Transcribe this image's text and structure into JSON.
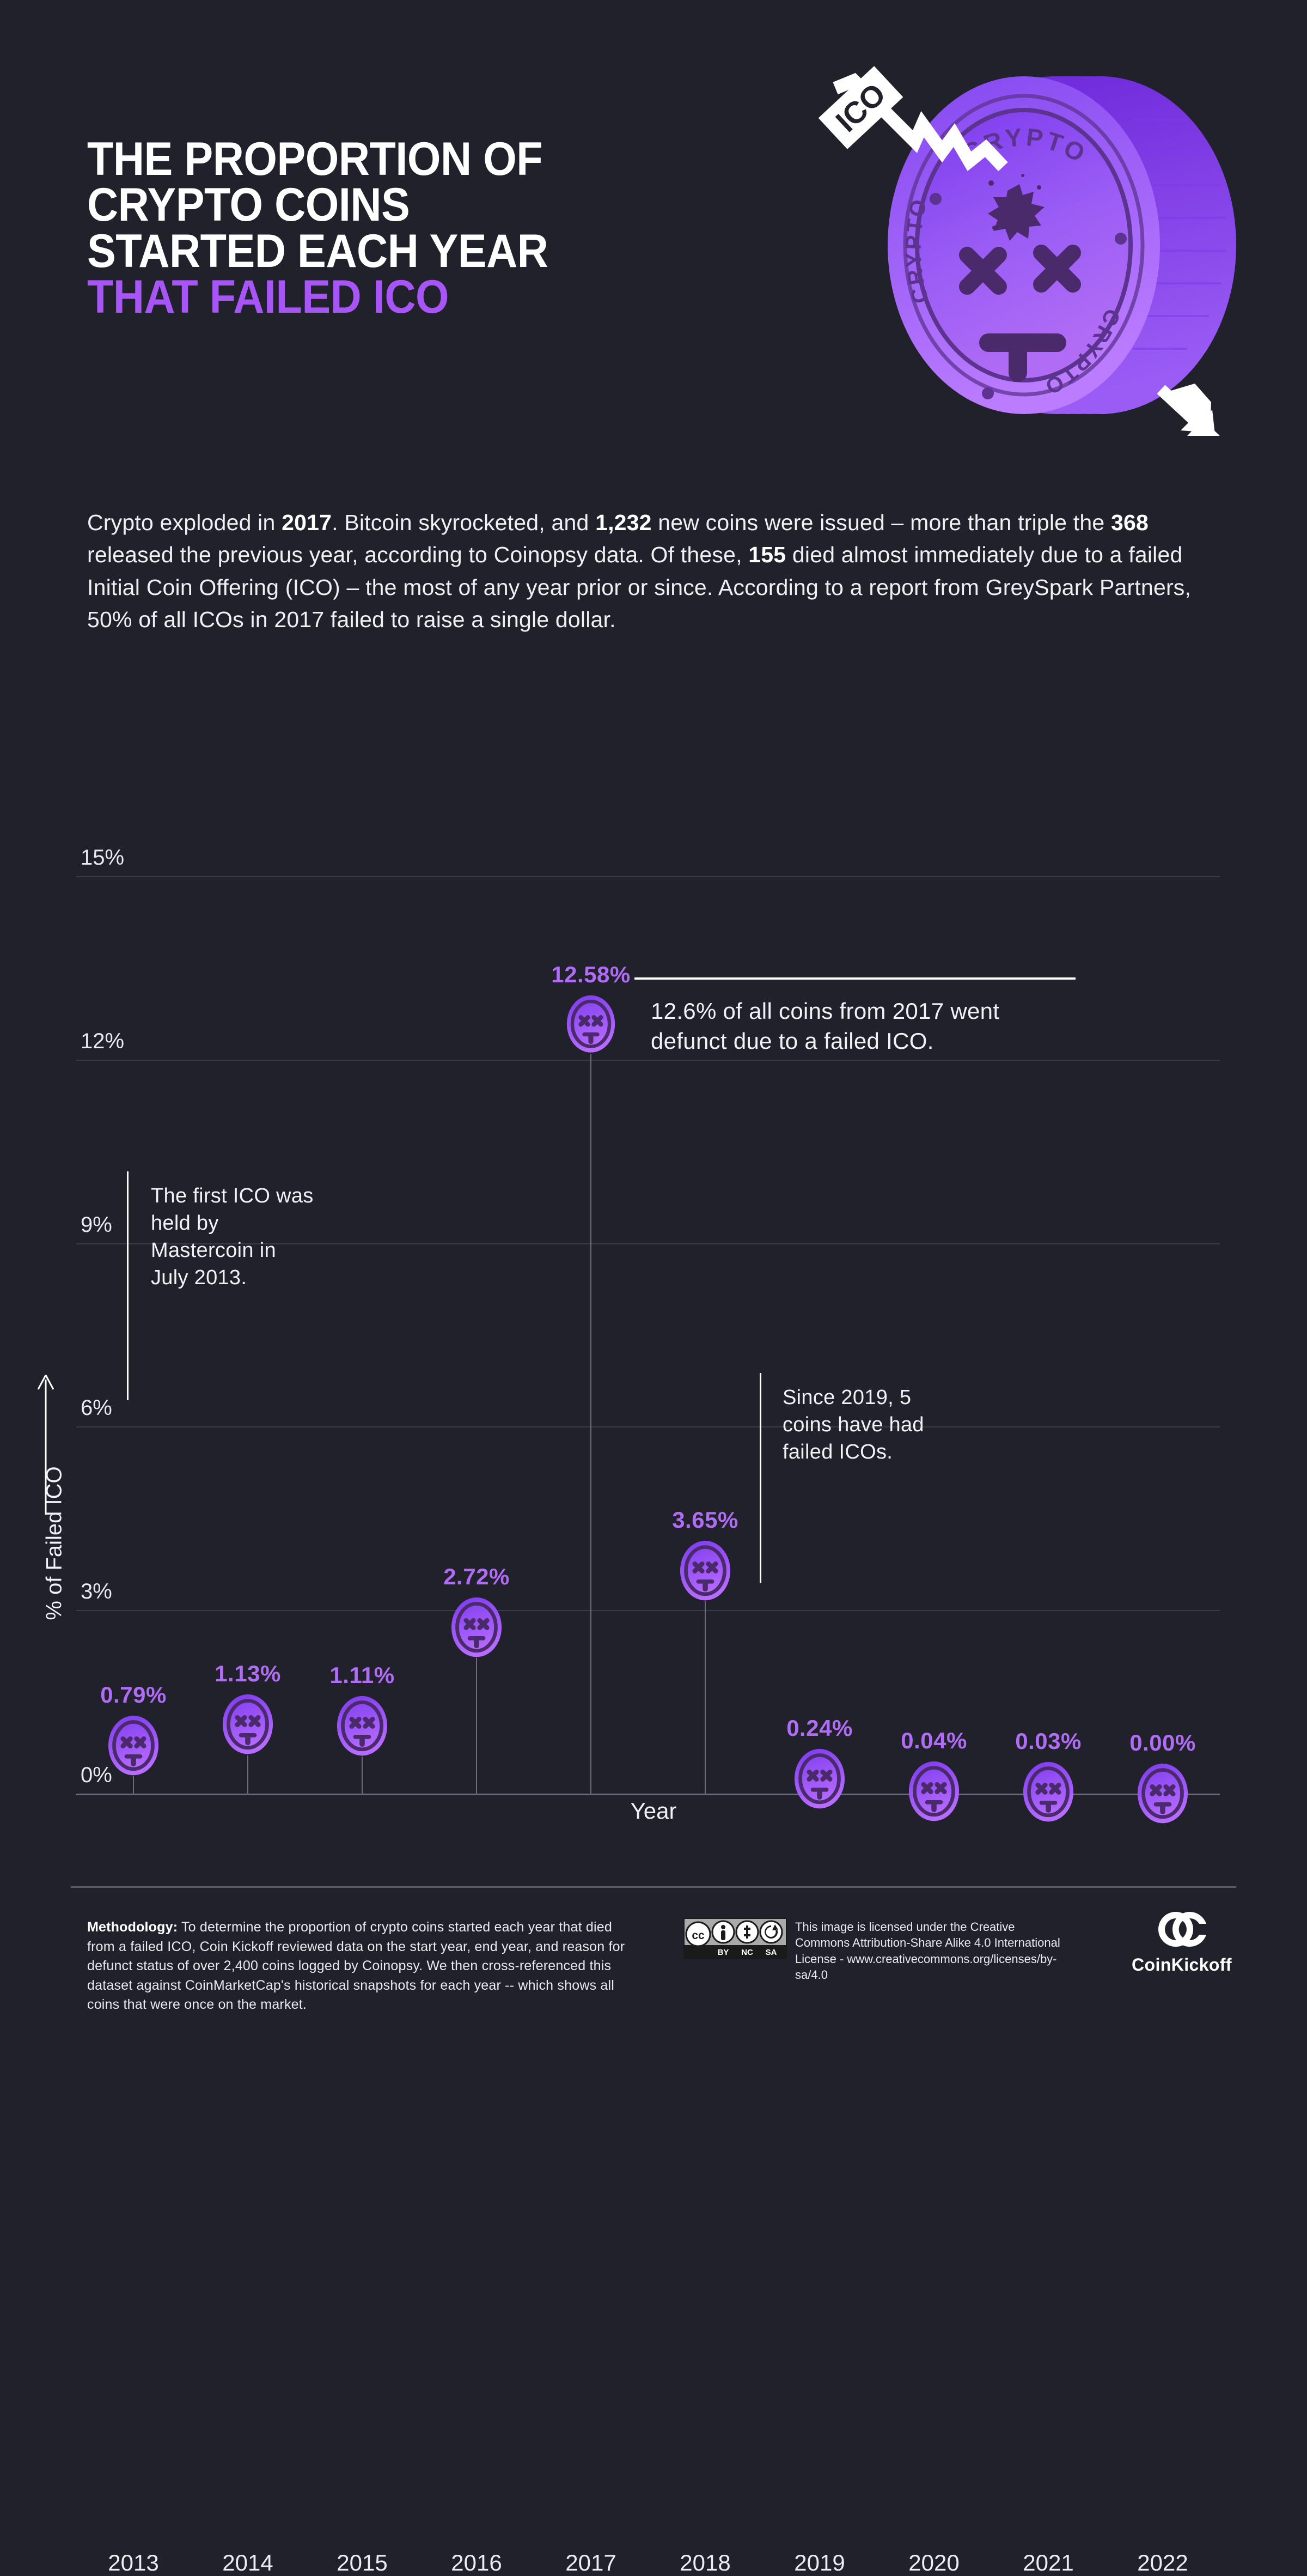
{
  "theme": {
    "background": "#21212c",
    "accent_purple": "#a855f7",
    "label_purple": "#b06cf5",
    "coin_light": "#b388ff",
    "coin_dark": "#7c3aed",
    "coin_outline": "#4a2a6b",
    "text_white": "#ffffff",
    "gridline": "#3a3a48"
  },
  "hero": {
    "title_lines": [
      "THE PROPORTION OF",
      "CRYPTO COINS",
      "STARTED EACH YEAR"
    ],
    "title_accent_line": "THAT FAILED ICO",
    "coin_face_text": "CRYPTO",
    "arrow_tag_label": "ICO"
  },
  "intro": {
    "paragraph_html": "Crypto exploded in <b>2017</b>. Bitcoin skyrocketed, and <b>1,232</b> new coins were issued – more than triple the <b>368</b> released the previous year, according to Coinopsy data. Of these, <b>155</b> died almost immediately due to a failed Initial Coin Offering (ICO) – the most of any year prior or since. According to a report from GreySpark Partners, 50% of all ICOs in 2017 failed to raise a single dollar."
  },
  "chart_data": {
    "type": "scatter",
    "title": "The proportion of crypto coins started each year that failed ICO",
    "xlabel": "Year",
    "ylabel": "% of Failed ICO",
    "categories": [
      "2013",
      "2014",
      "2015",
      "2016",
      "2017",
      "2018",
      "2019",
      "2020",
      "2021",
      "2022"
    ],
    "values": [
      0.79,
      1.13,
      1.11,
      2.72,
      12.58,
      3.65,
      0.24,
      0.04,
      0.03,
      0.0
    ],
    "value_labels": [
      "0.79%",
      "1.13%",
      "1.11%",
      "2.72%",
      "12.58%",
      "3.65%",
      "0.24%",
      "0.04%",
      "0.03%",
      "0.00%"
    ],
    "ylim": [
      0,
      15
    ],
    "ytick_values": [
      0,
      3,
      6,
      9,
      12,
      15
    ],
    "ytick_labels": [
      "0%",
      "3%",
      "6%",
      "9%",
      "12%",
      "15%"
    ],
    "grid": true,
    "legend": "none",
    "marker": "dead-coin-face",
    "annotations": [
      {
        "id": "peak-2017",
        "text": "12.6% of all coins from 2017 went defunct due to a failed ICO.",
        "anchor_year": "2017"
      },
      {
        "id": "first-ico",
        "text": "The first ICO was held by Mastercoin in July 2013.",
        "anchor_year": "2013"
      },
      {
        "id": "since-2019",
        "text": "Since 2019, 5 coins have had failed ICOs.",
        "anchor_year": "2019"
      }
    ]
  },
  "footer": {
    "methodology_label": "Methodology:",
    "methodology_text": " To determine the proportion of crypto coins started each year that died from a failed ICO, Coin Kickoff reviewed data on the start year, end year, and reason for defunct status of over 2,400 coins logged by Coinopsy. We then cross-referenced this dataset against CoinMarketCap's historical snapshots for each year -- which shows all coins that were once on the market.",
    "license_text": "This image is licensed under the Creative Commons Attribution-Share Alike 4.0 International License - www.creativecommons.org/licenses/by-sa/4.0",
    "license_badges": [
      "CC",
      "BY",
      "NC",
      "SA"
    ],
    "brand_name": "CoinKickoff"
  }
}
